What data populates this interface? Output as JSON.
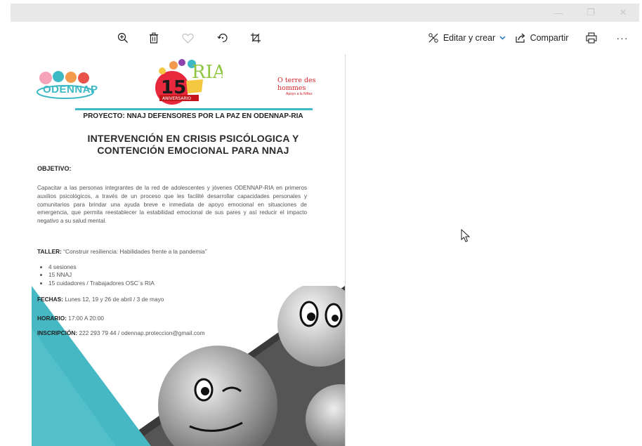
{
  "window": {
    "controls": {
      "minimize": "—",
      "maximize": "❐",
      "close": "✕"
    }
  },
  "toolbar": {
    "zoom_icon": "zoom-in-icon",
    "delete_icon": "trash-icon",
    "favorite_icon": "heart-icon",
    "rotate_icon": "rotate-icon",
    "crop_icon": "crop-icon",
    "edit_label": "Editar y crear",
    "share_label": "Compartir",
    "print_icon": "print-icon",
    "more_label": "···"
  },
  "document": {
    "logos": {
      "left": "ODENNAP",
      "center_number": "15",
      "center_text": "RIA",
      "center_sub": "ANIVERSARIO",
      "right_name": "terre des hommes",
      "right_sub": "Apoyo a la Niñez"
    },
    "project": "PROYECTO: NNAJ DEFENSORES POR LA PAZ EN ODENNAP-RIA",
    "headline": "INTERVENCIÓN EN CRISIS PSICÓLOGICA Y CONTENCIÓN EMOCIONAL PARA NNAJ",
    "objective_label": "OBJETIVO:",
    "objective_text": "Capacitar a las personas integrantes de la red de adolescentes y jóvenes ODENNAP-RIA en primeros auxilios psicológicos, a través de un proceso que les facilité desarrollar capacidades personales y comunitarios para brindar una ayuda breve e inmediata de apoyo emocional en situaciones de emergencia, que permita reestablecer la estabilidad emocional de sus pares y así reducir el impacto negativo a su salud mental.",
    "taller_label": "TALLER:",
    "taller_text": "“Construir resiliencia: Habilidades frente a la pandemia”",
    "bullets": [
      "4 sesiones",
      "15 NNAJ",
      "15 cuidadores / Trabajadores OSC´s RIA"
    ],
    "fechas_label": "FECHAS:",
    "fechas_text": "Lunes 12, 19 y 26 de abril / 3 de mayo",
    "horario_label": "HORARIO:",
    "horario_text": "17:00 A 20:00",
    "inscripcion_label": "INSCRIPCIÓN:",
    "inscripcion_text": "222 293 79 44 / odennap.proteccion@gmail.com"
  },
  "colors": {
    "accent_teal": "#3db9c6",
    "tdh_red": "#d2232a",
    "link_blue": "#1a73c8"
  }
}
